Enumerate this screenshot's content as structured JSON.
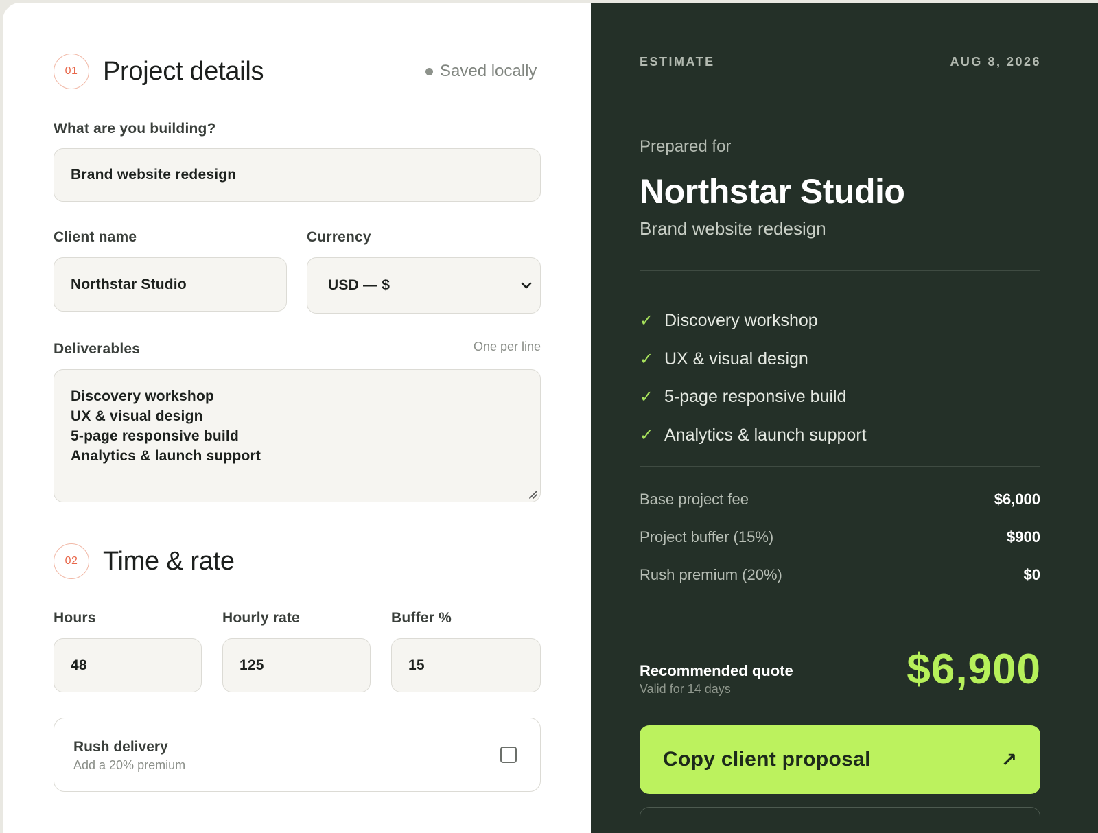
{
  "left": {
    "section1": {
      "step": "01",
      "title": "Project details",
      "status": "Saved locally"
    },
    "building": {
      "label": "What are you building?",
      "value": "Brand website redesign"
    },
    "client": {
      "label": "Client name",
      "value": "Northstar Studio"
    },
    "currency": {
      "label": "Currency",
      "value": "USD — $"
    },
    "deliverables": {
      "label": "Deliverables",
      "hint": "One per line",
      "lines": [
        "Discovery workshop",
        "UX & visual design",
        "5-page responsive build",
        "Analytics & launch support"
      ]
    },
    "section2": {
      "step": "02",
      "title": "Time & rate"
    },
    "hours": {
      "label": "Hours",
      "value": "48"
    },
    "rate": {
      "label": "Hourly rate",
      "value": "125"
    },
    "buffer": {
      "label": "Buffer %",
      "value": "15"
    },
    "rush": {
      "title": "Rush delivery",
      "subtitle": "Add a 20% premium",
      "checked": false
    }
  },
  "estimate": {
    "eyebrow": "ESTIMATE",
    "date": "AUG 8, 2026",
    "prepared_for_label": "Prepared for",
    "client": "Northstar Studio",
    "project": "Brand website redesign",
    "deliverables": [
      "Discovery workshop",
      "UX & visual design",
      "5-page responsive build",
      "Analytics & launch support"
    ],
    "line_items": [
      {
        "label": "Base project fee",
        "value": "$6,000"
      },
      {
        "label": "Project buffer (15%)",
        "value": "$900"
      },
      {
        "label": "Rush premium (20%)",
        "value": "$0"
      }
    ],
    "recommended_label": "Recommended quote",
    "validity": "Valid for 14 days",
    "total": "$6,900",
    "cta_label": "Copy client proposal",
    "cta_icon": "arrow-up-right-icon"
  },
  "colors": {
    "accent": "#bcf25e",
    "panel_dark": "#243028",
    "badge": "#e8674a"
  }
}
